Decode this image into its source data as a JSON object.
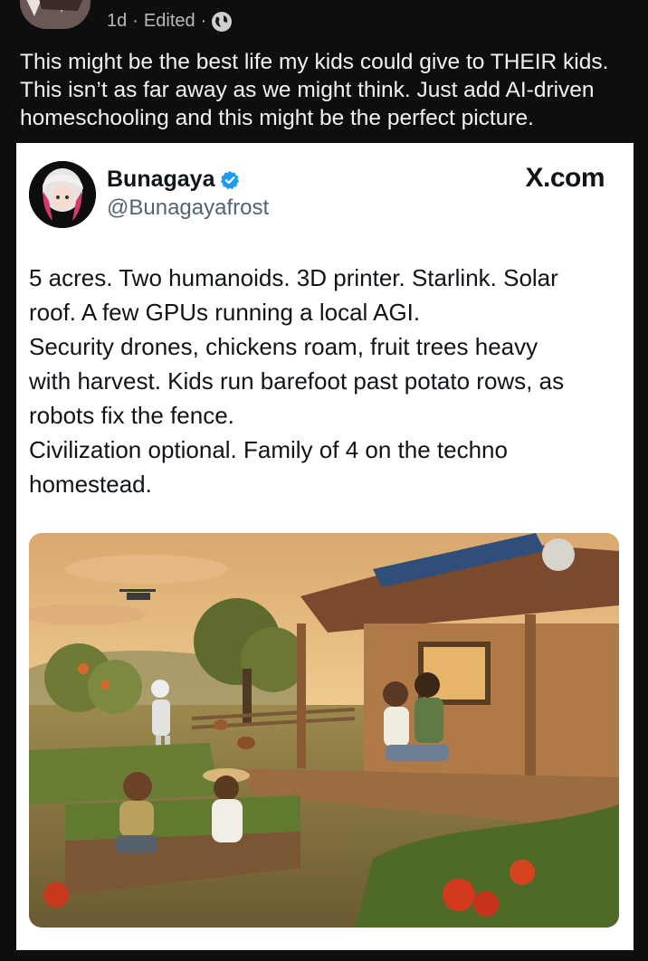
{
  "post": {
    "age": "1d",
    "edited": "Edited",
    "sep": "·",
    "caption_lines": [
      "This might be the best life my kids could give to THEIR kids.",
      "This isn’t as far away as we might think. Just add AI-driven",
      "homeschooling and this might be the perfect picture."
    ]
  },
  "tweet": {
    "name": "Bunagaya",
    "handle": "@Bunagayafrost",
    "source": "X.com",
    "lines": [
      "5 acres. Two humanoids. 3D printer. Starlink. Solar",
      "roof. A few GPUs running a local AGI.",
      "Security drones, chickens roam, fruit trees heavy",
      "with harvest. Kids run barefoot past potato rows, as",
      "robots fix the fence.",
      "Civilization optional. Family of 4 on the techno",
      "homestead."
    ]
  },
  "colors": {
    "page_bg": "#0e0e0e",
    "embed_bg": "#ffffff",
    "verified": "#1d9bf0",
    "handle": "#536471"
  }
}
